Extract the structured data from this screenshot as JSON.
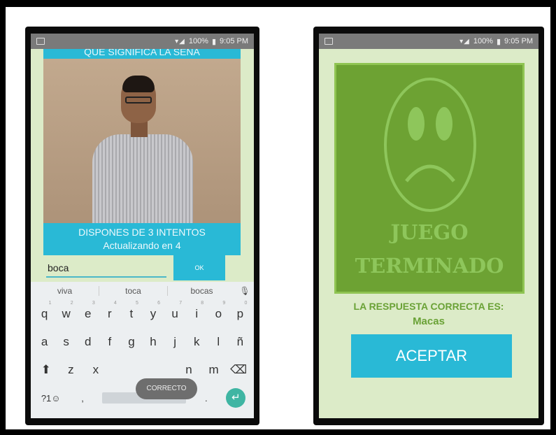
{
  "left_phone": {
    "status": {
      "battery": "100%",
      "time": "9:05 PM"
    },
    "title": "QUE SIGNIFICA LA SEÑA",
    "attempts_text": "DISPONES DE 3 INTENTOS",
    "update_text": "Actualizando en 4",
    "answer_value": "boca",
    "ok_label": "OK",
    "suggestions": [
      "viva",
      "toca",
      "bocas"
    ],
    "keyboard": {
      "row1": [
        "q",
        "w",
        "e",
        "r",
        "t",
        "y",
        "u",
        "i",
        "o",
        "p"
      ],
      "row1_hints": [
        "1",
        "2",
        "3",
        "4",
        "5",
        "6",
        "7",
        "8",
        "9",
        "0"
      ],
      "row2": [
        "a",
        "s",
        "d",
        "f",
        "g",
        "h",
        "j",
        "k",
        "l",
        "ñ"
      ],
      "row3": [
        "z",
        "x",
        "n",
        "m"
      ],
      "mode_key": "?1☺",
      "comma": ",",
      "period": "."
    },
    "tooltip": "CORRECTO"
  },
  "right_phone": {
    "status": {
      "battery": "100%",
      "time": "9:05 PM"
    },
    "game_over_line1": "JUEGO",
    "game_over_line2": "TERMINADO",
    "answer_label": "LA RESPUESTA CORRECTA ES:",
    "answer_word": "Macas",
    "accept_label": "ACEPTAR"
  },
  "colors": {
    "accent": "#29b9d6",
    "screen_bg": "#dcebc8",
    "panel": "#6da233",
    "face": "#8ec65b"
  }
}
